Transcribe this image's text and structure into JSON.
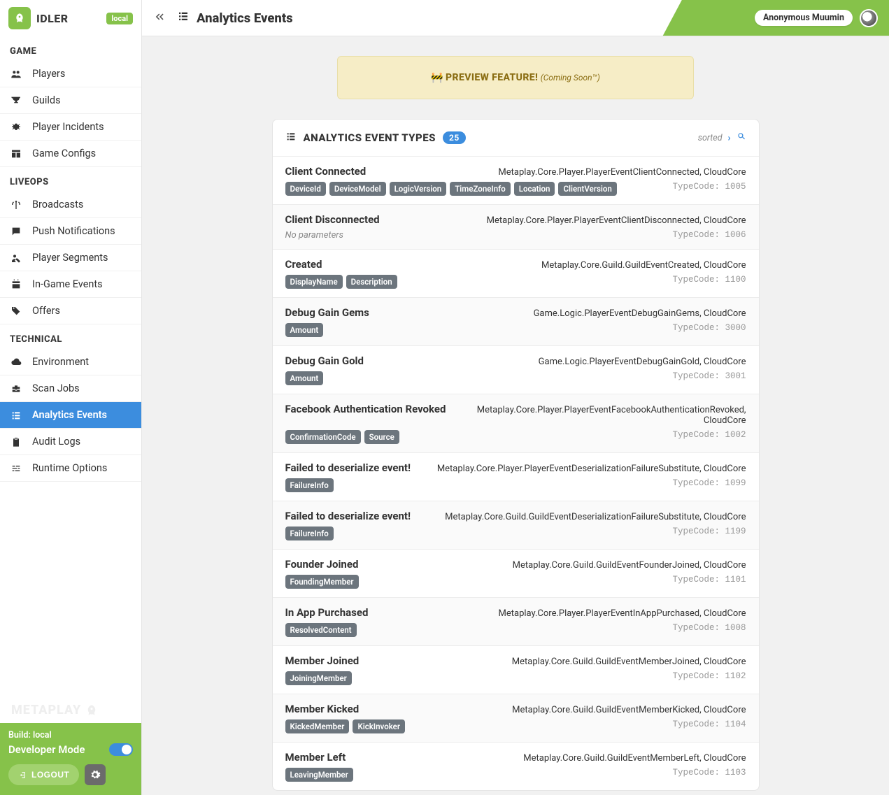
{
  "app": {
    "title": "IDLER",
    "env_badge": "local"
  },
  "sidebar": {
    "sections": [
      {
        "title": "GAME",
        "items": [
          {
            "label": "Players",
            "icon": "users-icon"
          },
          {
            "label": "Guilds",
            "icon": "trophy-icon"
          },
          {
            "label": "Player Incidents",
            "icon": "bug-icon"
          },
          {
            "label": "Game Configs",
            "icon": "table-icon"
          }
        ]
      },
      {
        "title": "LIVEOPS",
        "items": [
          {
            "label": "Broadcasts",
            "icon": "antenna-icon"
          },
          {
            "label": "Push Notifications",
            "icon": "comment-icon"
          },
          {
            "label": "Player Segments",
            "icon": "user-tag-icon"
          },
          {
            "label": "In-Game Events",
            "icon": "calendar-icon"
          },
          {
            "label": "Offers",
            "icon": "tags-icon"
          }
        ]
      },
      {
        "title": "TECHNICAL",
        "items": [
          {
            "label": "Environment",
            "icon": "cloud-icon"
          },
          {
            "label": "Scan Jobs",
            "icon": "toolbox-icon"
          },
          {
            "label": "Analytics Events",
            "icon": "list-icon",
            "active": true
          },
          {
            "label": "Audit Logs",
            "icon": "clipboard-icon"
          },
          {
            "label": "Runtime Options",
            "icon": "sliders-icon"
          }
        ]
      }
    ],
    "brand_mark": "METAPLAY",
    "footer": {
      "build_line": "Build: local",
      "mode_label": "Developer Mode",
      "logout_label": "LOGOUT"
    }
  },
  "header": {
    "title": "Analytics Events",
    "user": "Anonymous Muumin"
  },
  "preview": {
    "title": "PREVIEW FEATURE!",
    "sub": "(Coming Soon™)"
  },
  "list": {
    "title": "ANALYTICS EVENT TYPES",
    "count": "25",
    "sort_label": "sorted",
    "typecode_label": "TypeCode:",
    "no_params": "No parameters",
    "rows": [
      {
        "name": "Client Connected",
        "cls": "Metaplay.Core.Player.PlayerEventClientConnected, CloudCore",
        "code": "1005",
        "params": [
          "DeviceId",
          "DeviceModel",
          "LogicVersion",
          "TimeZoneInfo",
          "Location",
          "ClientVersion"
        ]
      },
      {
        "name": "Client Disconnected",
        "cls": "Metaplay.Core.Player.PlayerEventClientDisconnected, CloudCore",
        "code": "1006",
        "params": []
      },
      {
        "name": "Created",
        "cls": "Metaplay.Core.Guild.GuildEventCreated, CloudCore",
        "code": "1100",
        "params": [
          "DisplayName",
          "Description"
        ]
      },
      {
        "name": "Debug Gain Gems",
        "cls": "Game.Logic.PlayerEventDebugGainGems, CloudCore",
        "code": "3000",
        "params": [
          "Amount"
        ]
      },
      {
        "name": "Debug Gain Gold",
        "cls": "Game.Logic.PlayerEventDebugGainGold, CloudCore",
        "code": "3001",
        "params": [
          "Amount"
        ]
      },
      {
        "name": "Facebook Authentication Revoked",
        "cls": "Metaplay.Core.Player.PlayerEventFacebookAuthenticationRevoked, CloudCore",
        "code": "1002",
        "params": [
          "ConfirmationCode",
          "Source"
        ]
      },
      {
        "name": "Failed to deserialize event!",
        "cls": "Metaplay.Core.Player.PlayerEventDeserializationFailureSubstitute, CloudCore",
        "code": "1099",
        "params": [
          "FailureInfo"
        ]
      },
      {
        "name": "Failed to deserialize event!",
        "cls": "Metaplay.Core.Guild.GuildEventDeserializationFailureSubstitute, CloudCore",
        "code": "1199",
        "params": [
          "FailureInfo"
        ]
      },
      {
        "name": "Founder Joined",
        "cls": "Metaplay.Core.Guild.GuildEventFounderJoined, CloudCore",
        "code": "1101",
        "params": [
          "FoundingMember"
        ]
      },
      {
        "name": "In App Purchased",
        "cls": "Metaplay.Core.Player.PlayerEventInAppPurchased, CloudCore",
        "code": "1008",
        "params": [
          "ResolvedContent"
        ]
      },
      {
        "name": "Member Joined",
        "cls": "Metaplay.Core.Guild.GuildEventMemberJoined, CloudCore",
        "code": "1102",
        "params": [
          "JoiningMember"
        ]
      },
      {
        "name": "Member Kicked",
        "cls": "Metaplay.Core.Guild.GuildEventMemberKicked, CloudCore",
        "code": "1104",
        "params": [
          "KickedMember",
          "KickInvoker"
        ]
      },
      {
        "name": "Member Left",
        "cls": "Metaplay.Core.Guild.GuildEventMemberLeft, CloudCore",
        "code": "1103",
        "params": [
          "LeavingMember"
        ]
      }
    ]
  }
}
